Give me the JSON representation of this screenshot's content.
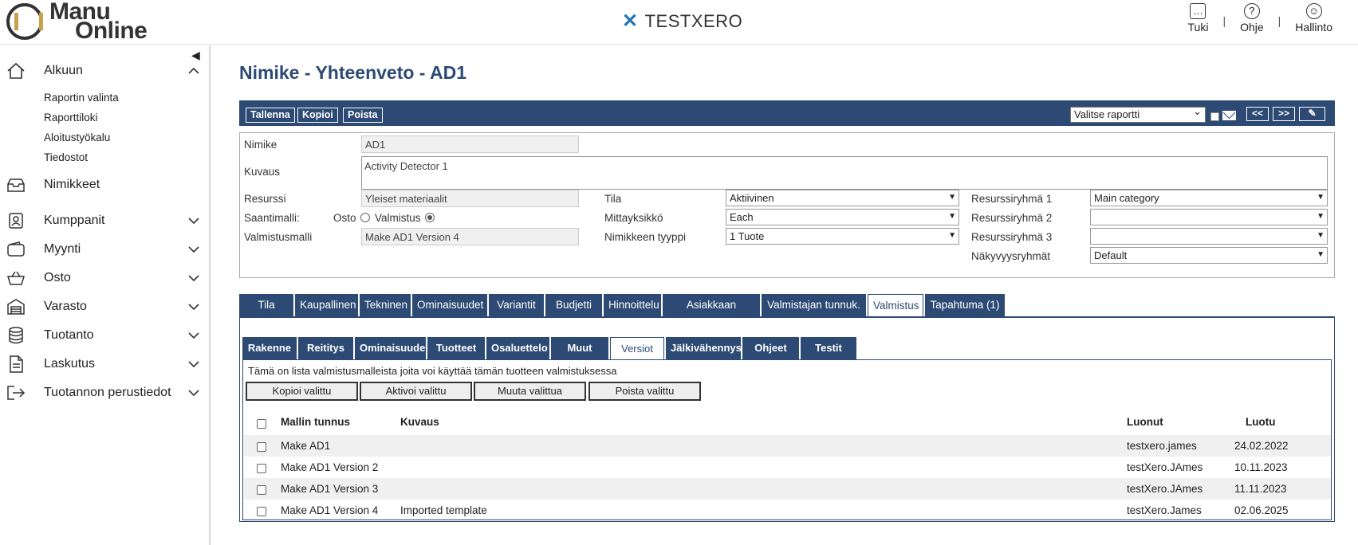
{
  "header": {
    "logo_line1": "Manu",
    "logo_line2": "Online",
    "brand": "TESTXERO",
    "links": [
      {
        "label": "Tuki",
        "icon": "chat-icon"
      },
      {
        "label": "Ohje",
        "icon": "help-icon"
      },
      {
        "label": "Hallinto",
        "icon": "user-icon"
      }
    ]
  },
  "sidebar": {
    "home": "Alkuun",
    "sub_items": [
      "Raportin valinta",
      "Raporttiloki",
      "Aloitustyökalu",
      "Tiedostot"
    ],
    "items": [
      "Nimikkeet",
      "Kumppanit",
      "Myynti",
      "Osto",
      "Varasto",
      "Tuotanto",
      "Laskutus",
      "Tuotannon perustiedot"
    ]
  },
  "page": {
    "title": "Nimike - Yhteenveto - AD1"
  },
  "toolbar": {
    "save": "Tallenna",
    "copy": "Kopioi",
    "delete": "Poista",
    "report_select": "Valitse raportti",
    "prev": "<<",
    "next": ">>",
    "attach": "✎"
  },
  "form": {
    "nimike_label": "Nimike",
    "nimike_value": "AD1",
    "kuvaus_label": "Kuvaus",
    "kuvaus_value": "Activity Detector 1",
    "resurssi_label": "Resurssi",
    "resurssi_value": "Yleiset materiaalit",
    "saantimalli_label": "Saantimalli:",
    "osto_label": "Osto",
    "valmistus_label": "Valmistus",
    "valmistusmalli_label": "Valmistusmalli",
    "valmistusmalli_value": "Make AD1 Version 4",
    "tila_label": "Tila",
    "tila_value": "Aktiivinen",
    "mittayksikko_label": "Mittayksikkö",
    "mittayksikko_value": "Each",
    "tyyppi_label": "Nimikkeen tyyppi",
    "tyyppi_value": "1 Tuote",
    "rr1_label": "Resurssiryhmä 1",
    "rr1_value": "Main category",
    "rr2_label": "Resurssiryhmä 2",
    "rr2_value": "",
    "rr3_label": "Resurssiryhmä 3",
    "rr3_value": "",
    "nakyvyys_label": "Näkyvyysryhmät",
    "nakyvyys_value": "Default"
  },
  "tabs_main": [
    "Tila",
    "Kaupallinen",
    "Tekninen",
    "Ominaisuudet",
    "Variantit",
    "Budjetti",
    "Hinnoittelu",
    "Asiakkaan tunnuk.",
    "Valmistajan tunnuk.",
    "Valmistus",
    "Tapahtuma (1)"
  ],
  "tabs_main_active": "Valmistus",
  "tabs_sub": [
    "Rakenne",
    "Reititys",
    "Ominaisuudet",
    "Tuotteet",
    "Osaluettelo",
    "Muut tiedot",
    "Versiot",
    "Jälkivähennys",
    "Ohjeet",
    "Testit"
  ],
  "tabs_sub_active": "Versiot",
  "versions": {
    "info": "Tämä on lista valmistusmalleista joita voi käyttää tämän tuotteen valmistuksessa",
    "buttons": [
      "Kopioi valittu",
      "Aktivoi valittu",
      "Muuta valittua",
      "Poista valittu"
    ],
    "columns": {
      "id": "Mallin tunnus",
      "desc": "Kuvaus",
      "creator": "Luonut",
      "created": "Luotu"
    },
    "rows": [
      {
        "id": "Make AD1",
        "desc": "",
        "creator": "testxero.james",
        "created": "24.02.2022"
      },
      {
        "id": "Make AD1 Version 2",
        "desc": "",
        "creator": "testXero.JAmes",
        "created": "10.11.2023"
      },
      {
        "id": "Make AD1 Version 3",
        "desc": "",
        "creator": "testXero.JAmes",
        "created": "11.11.2023"
      },
      {
        "id": "Make AD1 Version 4",
        "desc": "Imported template",
        "creator": "testXero.James",
        "created": "02.06.2025"
      }
    ]
  }
}
